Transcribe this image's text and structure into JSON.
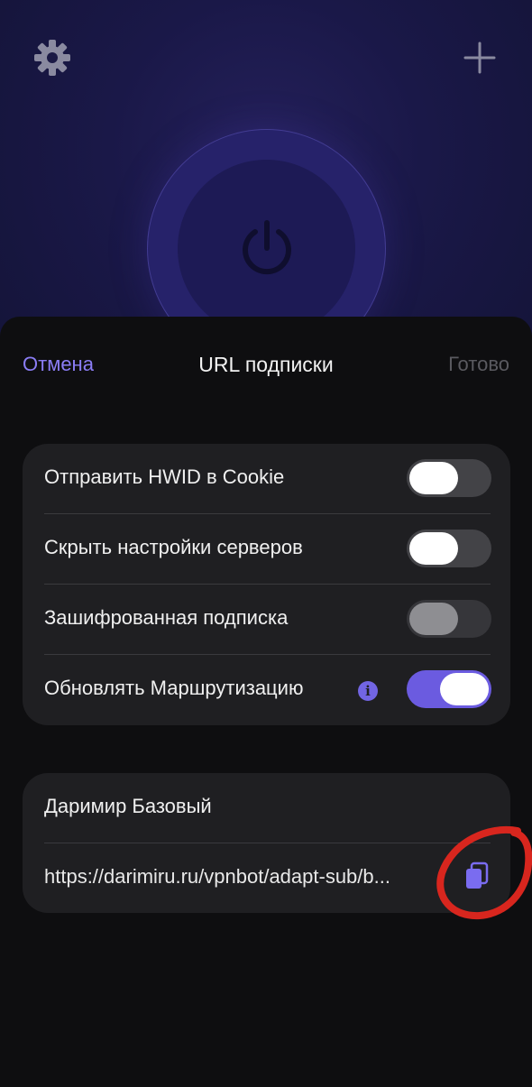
{
  "colors": {
    "accent": "#6b5be0",
    "accent_text": "#8b7df5",
    "sheet_bg": "#0e0e10",
    "group_bg": "#1f1f22",
    "annotation": "#d8261e"
  },
  "background": {
    "settings_icon": "gear-icon",
    "add_icon": "plus-icon",
    "power_icon": "power-icon"
  },
  "sheet": {
    "cancel_label": "Отмена",
    "title": "URL подписки",
    "done_label": "Готово"
  },
  "settings": [
    {
      "label": "Отправить HWID в Cookie",
      "state": "off"
    },
    {
      "label": "Скрыть настройки серверов",
      "state": "off"
    },
    {
      "label": "Зашифрованная подписка",
      "state": "disabled"
    },
    {
      "label": "Обновлять Маршрутизацию",
      "state": "on",
      "info_icon": "info-icon"
    }
  ],
  "subscription": {
    "name": "Даримир Базовый",
    "url": "https://darimiru.ru/vpnbot/adapt-sub/b...",
    "copy_icon": "copy-icon"
  }
}
